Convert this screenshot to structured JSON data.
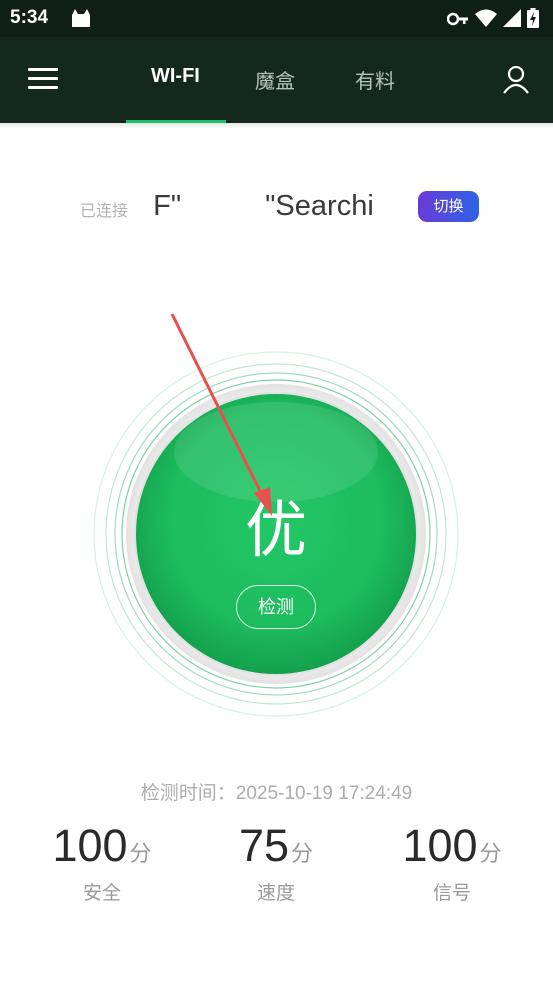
{
  "status_bar": {
    "time": "5:34",
    "icons": [
      "cat-notification-icon",
      "vpn-key-icon",
      "wifi-icon",
      "cell-signal-icon",
      "battery-charging-icon"
    ]
  },
  "app_bar": {
    "tabs": [
      {
        "label": "WI-FI",
        "active": true
      },
      {
        "label": "魔盒",
        "active": false
      },
      {
        "label": "有料",
        "active": false
      }
    ],
    "accent": "#1ec06a"
  },
  "connection": {
    "status_label": "已连接",
    "ssid_fragment_1": "uF\"",
    "ssid_fragment_2": "\"Searchi",
    "switch_label": "切换"
  },
  "gauge": {
    "result": "优",
    "check_button": "检测",
    "color": "#1dbb5e"
  },
  "check_time": "检测时间：2025-10-19 17:24:49",
  "stats": [
    {
      "value": "100",
      "unit": "分",
      "label": "安全"
    },
    {
      "value": "75",
      "unit": "分",
      "label": "速度"
    },
    {
      "value": "100",
      "unit": "分",
      "label": "信号"
    }
  ]
}
